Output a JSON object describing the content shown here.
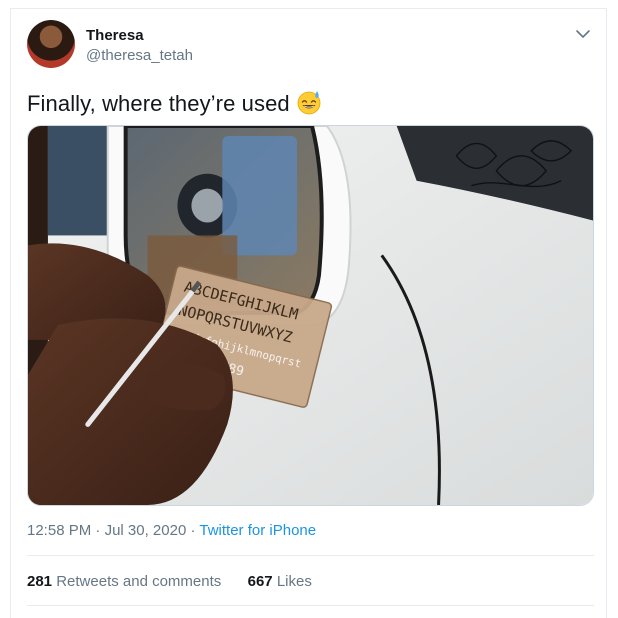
{
  "author": {
    "name": "Theresa",
    "handle": "@theresa_tetah"
  },
  "tweet": {
    "text": "Finally, where they’re used",
    "emoji_icon": "grinning-sweat-emoji"
  },
  "media": {
    "stencil_lines": [
      "ABCDEFGHIJKLM",
      "NOPQRSTUVWXYZ",
      "abcdefghijklmnopqrst",
      "0123456789"
    ]
  },
  "meta": {
    "time": "12:58 PM",
    "separator": "·",
    "date": "Jul 30, 2020",
    "source": "Twitter for iPhone"
  },
  "stats": {
    "retweets_count": "281",
    "retweets_label": "Retweets and comments",
    "likes_count": "667",
    "likes_label": "Likes"
  },
  "colors": {
    "link": "#1b95e0",
    "secondary_text": "#657786",
    "border": "#e6ecf0"
  }
}
